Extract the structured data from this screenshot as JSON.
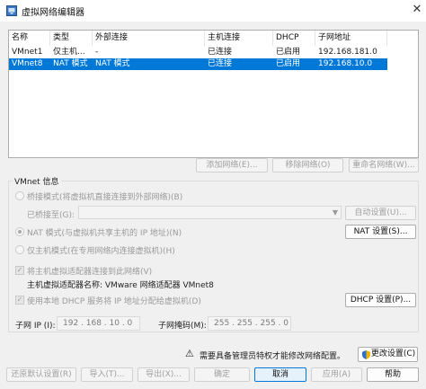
{
  "window": {
    "title": "虚拟网络编辑器",
    "close_glyph": "✕"
  },
  "table": {
    "headers": [
      "名称",
      "类型",
      "外部连接",
      "主机连接",
      "DHCP",
      "子网地址"
    ],
    "rows": [
      {
        "name": "VMnet1",
        "type": "仅主机...",
        "external": "-",
        "host": "已连接",
        "dhcp": "已启用",
        "subnet": "192.168.181.0"
      },
      {
        "name": "VMnet8",
        "type": "NAT 模式",
        "external": "NAT 模式",
        "host": "已连接",
        "dhcp": "已启用",
        "subnet": "192.168.10.0",
        "selected": true
      }
    ]
  },
  "table_buttons": {
    "add": "添加网络(E)...",
    "remove": "移除网络(O)",
    "rename": "重命名网络(W)..."
  },
  "vmnet_info": {
    "label": "VMnet 信息",
    "bridged_radio": "桥接模式(将虚拟机直接连接到外部网络)(B)",
    "bridged_to_label": "已桥接至(G):",
    "bridged_to_value": "",
    "auto_settings": "自动设置(U)...",
    "nat_radio": "NAT 模式(与虚拟机共享主机的 IP 地址)(N)",
    "nat_settings": "NAT 设置(S)...",
    "hostonly_radio": "仅主机模式(在专用网络内连接虚拟机)(H)",
    "connect_adapter_check": "将主机虚拟适配器连接到此网络(V)",
    "adapter_name_label": "主机虚拟适配器名称: VMware 网络适配器 VMnet8",
    "dhcp_check": "使用本地 DHCP 服务将 IP 地址分配给虚拟机(D)",
    "dhcp_settings": "DHCP 设置(P)...",
    "subnet_ip_label": "子网 IP (I):",
    "subnet_ip_value": "192 . 168 . 10 . 0",
    "subnet_mask_label": "子网掩码(M):",
    "subnet_mask_value": "255 . 255 . 255 . 0"
  },
  "admin_notice": {
    "warning_glyph": "⚠",
    "text": "需要具备管理员特权才能修改网络配置。",
    "change_settings": "更改设置(C)"
  },
  "footer": {
    "restore": "还原默认设置(R)",
    "import": "导入(T)...",
    "export": "导出(X)...",
    "ok": "确定",
    "cancel": "取消",
    "apply": "应用(A)",
    "help": "帮助"
  },
  "colors": {
    "selection": "#0078d7",
    "window_bg": "#f0f0f0"
  },
  "icons": [
    "network-editor-icon",
    "close-icon",
    "warning-icon",
    "shield-icon",
    "chevron-down-icon"
  ]
}
